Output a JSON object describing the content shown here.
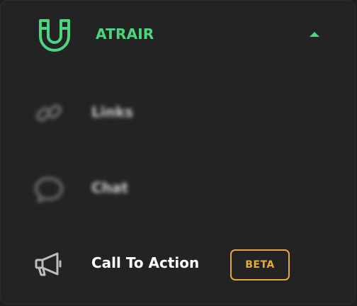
{
  "colors": {
    "panel_background": "#232323",
    "accent_green": "#4cd580",
    "beta_gold": "#e3a93b",
    "text_white": "#ffffff"
  },
  "header": {
    "title": "ATRAIR",
    "icon": "magnet-icon",
    "toggle_icon": "chevron-up-icon",
    "expanded": true
  },
  "menu": {
    "items": [
      {
        "label": "Links",
        "icon": "link-icon",
        "blurred": true
      },
      {
        "label": "Chat",
        "icon": "chat-bubble-icon",
        "blurred": true
      },
      {
        "label": "Call To Action",
        "icon": "megaphone-icon",
        "blurred": false,
        "badge": "BETA"
      }
    ]
  }
}
